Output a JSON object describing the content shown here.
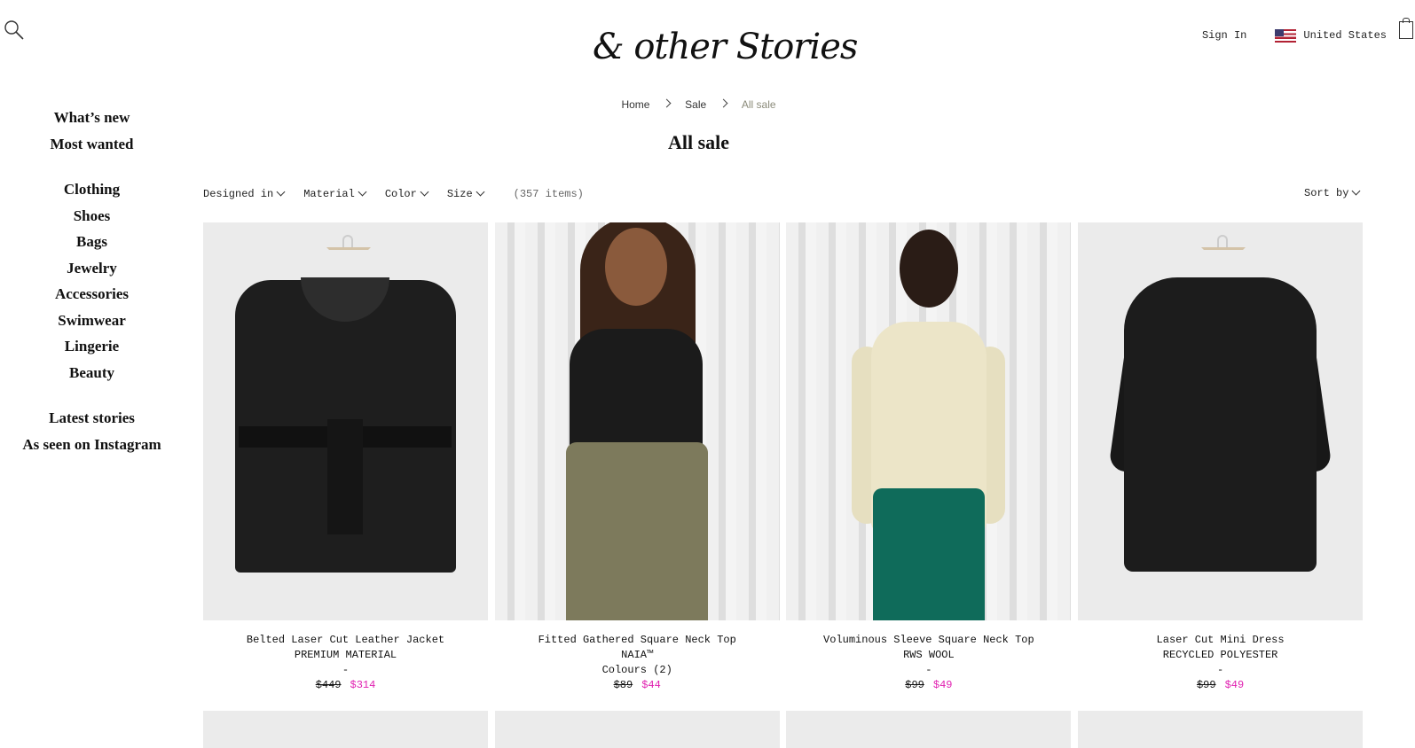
{
  "header": {
    "logo_text": "& other Stories",
    "sign_in": "Sign In",
    "country": "United States"
  },
  "sidebar": {
    "group1": [
      "What’s new",
      "Most wanted"
    ],
    "group2": [
      "Clothing",
      "Shoes",
      "Bags",
      "Jewelry",
      "Accessories",
      "Swimwear",
      "Lingerie",
      "Beauty"
    ],
    "group3": [
      "Latest stories",
      "As seen on Instagram"
    ]
  },
  "breadcrumb": {
    "items": [
      "Home",
      "Sale",
      "All sale"
    ]
  },
  "page_title": "All sale",
  "filters": {
    "items": [
      "Designed in",
      "Material",
      "Color",
      "Size"
    ],
    "count": "(357 items)",
    "sort_label": "Sort by"
  },
  "products": [
    {
      "name": "Belted Laser Cut Leather Jacket",
      "material": "PREMIUM MATERIAL",
      "extra": "-",
      "price_old": "$449",
      "price_new": "$314"
    },
    {
      "name": "Fitted Gathered Square Neck Top",
      "material": "NAIA™",
      "extra": "Colours (2)",
      "price_old": "$89",
      "price_new": "$44"
    },
    {
      "name": "Voluminous Sleeve Square Neck Top",
      "material": "RWS WOOL",
      "extra": "-",
      "price_old": "$99",
      "price_new": "$49"
    },
    {
      "name": "Laser Cut Mini Dress",
      "material": "RECYCLED POLYESTER",
      "extra": "-",
      "price_old": "$99",
      "price_new": "$49"
    }
  ],
  "colors": {
    "sale_price": "#e020b0",
    "text": "#111111",
    "breadcrumb_current": "#8b8b7a"
  },
  "icons": [
    "search-icon",
    "flag-us-icon",
    "shopping-bag-icon",
    "chevron-right-icon",
    "chevron-down-icon"
  ]
}
